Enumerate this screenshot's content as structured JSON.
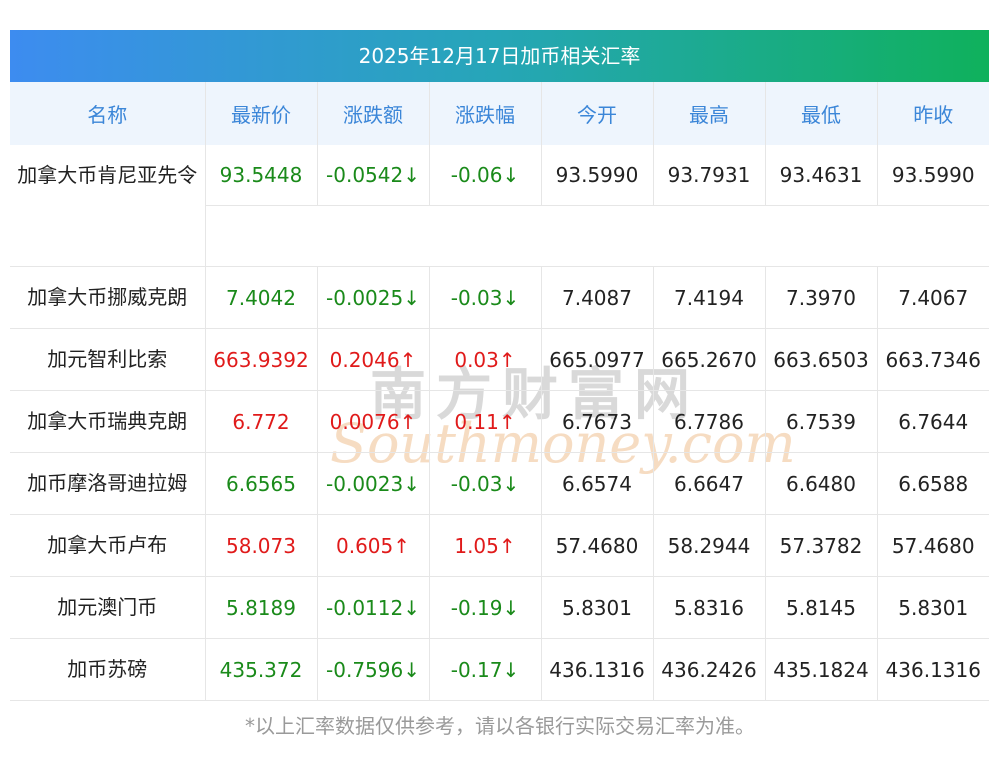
{
  "title": "2025年12月17日加币相关汇率",
  "headers": [
    "名称",
    "最新价",
    "涨跌额",
    "涨跌幅",
    "今开",
    "最高",
    "最低",
    "昨收"
  ],
  "rows": [
    {
      "name": "加拿大币肯尼亚先令",
      "latest": "93.5448",
      "change": "-0.0542↓",
      "pct": "-0.06↓",
      "open": "93.5990",
      "high": "93.7931",
      "low": "93.4631",
      "prev": "93.5990",
      "dir": "down"
    },
    {
      "name": "加拿大币挪威克朗",
      "latest": "7.4042",
      "change": "-0.0025↓",
      "pct": "-0.03↓",
      "open": "7.4087",
      "high": "7.4194",
      "low": "7.3970",
      "prev": "7.4067",
      "dir": "down"
    },
    {
      "name": "加元智利比索",
      "latest": "663.9392",
      "change": "0.2046↑",
      "pct": "0.03↑",
      "open": "665.0977",
      "high": "665.2670",
      "low": "663.6503",
      "prev": "663.7346",
      "dir": "up"
    },
    {
      "name": "加拿大币瑞典克朗",
      "latest": "6.772",
      "change": "0.0076↑",
      "pct": "0.11↑",
      "open": "6.7673",
      "high": "6.7786",
      "low": "6.7539",
      "prev": "6.7644",
      "dir": "up"
    },
    {
      "name": "加币摩洛哥迪拉姆",
      "latest": "6.6565",
      "change": "-0.0023↓",
      "pct": "-0.03↓",
      "open": "6.6574",
      "high": "6.6647",
      "low": "6.6480",
      "prev": "6.6588",
      "dir": "down"
    },
    {
      "name": "加拿大币卢布",
      "latest": "58.073",
      "change": "0.605↑",
      "pct": "1.05↑",
      "open": "57.4680",
      "high": "58.2944",
      "low": "57.3782",
      "prev": "57.4680",
      "dir": "up"
    },
    {
      "name": "加元澳门币",
      "latest": "5.8189",
      "change": "-0.0112↓",
      "pct": "-0.19↓",
      "open": "5.8301",
      "high": "5.8316",
      "low": "5.8145",
      "prev": "5.8301",
      "dir": "down"
    },
    {
      "name": "加币苏磅",
      "latest": "435.372",
      "change": "-0.7596↓",
      "pct": "-0.17↓",
      "open": "436.1316",
      "high": "436.2426",
      "low": "435.1824",
      "prev": "436.1316",
      "dir": "down"
    }
  ],
  "watermark": {
    "cn": "南方财富网",
    "en": "Southmoney.com"
  },
  "footer": "*以上汇率数据仅供参考，请以各银行实际交易汇率为准。",
  "colors": {
    "up": "#e01a1a",
    "down": "#1a8a1a",
    "header_text": "#3b86d8",
    "header_bg": "#eef5fd"
  }
}
